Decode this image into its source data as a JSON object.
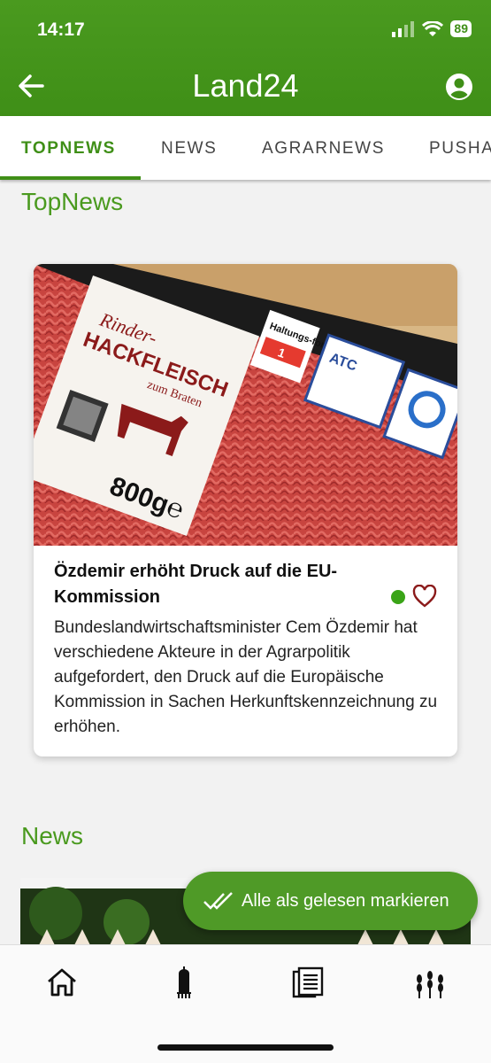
{
  "status_bar": {
    "time": "14:17",
    "battery": "89"
  },
  "app_bar": {
    "title": "Land24"
  },
  "tabs": [
    {
      "label": "TOPNEWS",
      "active": true
    },
    {
      "label": "NEWS",
      "active": false
    },
    {
      "label": "AGRARNEWS",
      "active": false
    },
    {
      "label": "PUSHA",
      "active": false
    }
  ],
  "sections": {
    "topnews_title": "TopNews",
    "news_title": "News"
  },
  "top_article": {
    "title": "Özdemir erhöht Druck auf die EU-Kommission",
    "body": "Bundeslandwirtschaftsminister Cem Özdemir hat verschiedene Akteure in der Agrarpolitik aufgefordert, den Druck auf die Europäische Kommission in Sachen Herkunftskennzeichnung zu erhöhen.",
    "image_label_1": "Rinder-",
    "image_label_2": "HACKFLEISCH",
    "image_label_3": "zum Braten",
    "image_weight": "800g℮",
    "image_badge": "Haltungs-form",
    "image_badge_value": "1",
    "image_atc": "ATC"
  },
  "fab": {
    "label": "Alle als gelesen markieren"
  },
  "bottom_nav": [
    {
      "icon": "home-icon"
    },
    {
      "icon": "silo-icon"
    },
    {
      "icon": "newspaper-icon"
    },
    {
      "icon": "wheat-icon"
    }
  ],
  "colors": {
    "primary": "#3f8f17",
    "accent_dot": "#3aa417",
    "heart": "#8b1a1a"
  }
}
